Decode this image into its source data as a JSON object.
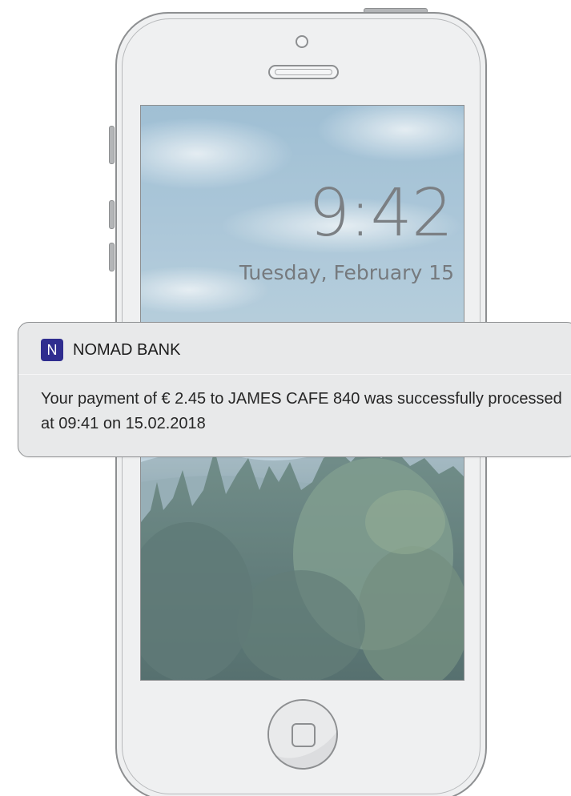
{
  "lockscreen": {
    "time": "9:42",
    "date": "Tuesday, February 15"
  },
  "notification": {
    "app_icon_letter": "N",
    "app_name": "NOMAD BANK",
    "message": "Your payment of € 2.45 to JAMES CAFE 840 was successfully processed at 09:41 on 15.02.2018"
  },
  "colors": {
    "app_icon_bg": "#2f2d8f",
    "phone_frame": "#eff0f1",
    "phone_outline": "#8d8f91",
    "notification_bg": "#e8e9ea"
  },
  "icons": {
    "home_button": "home-button-icon",
    "camera": "front-camera-icon",
    "speaker": "speaker-icon"
  }
}
